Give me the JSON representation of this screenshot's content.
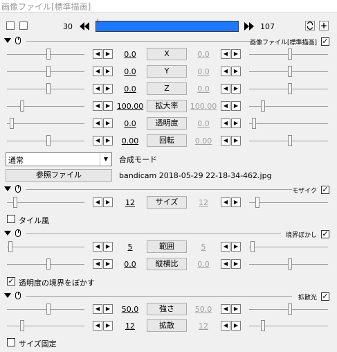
{
  "title_bar": {
    "text": "画像ファイル[標準描画]"
  },
  "toolbar": {
    "start_frame": "30",
    "end_frame": "107",
    "plus_label": "+"
  },
  "sections": {
    "image": {
      "title": "画像ファイル[標準描画]",
      "checked": "✓"
    },
    "mosaic": {
      "title": "モザイク",
      "checked": "✓"
    },
    "border_blur": {
      "title": "境界ぼかし",
      "checked": "✓"
    },
    "diffuse": {
      "title": "拡散光",
      "checked": "✓"
    }
  },
  "params": {
    "x": {
      "label": "X",
      "left": "0.0",
      "right": "0.0"
    },
    "y": {
      "label": "Y",
      "left": "0.0",
      "right": "0.0"
    },
    "z": {
      "label": "Z",
      "left": "0.0",
      "right": "0.0"
    },
    "zoom": {
      "label": "拡大率",
      "left": "100.00",
      "right": "100.00"
    },
    "alpha": {
      "label": "透明度",
      "left": "0.0",
      "right": "0.0"
    },
    "rotate": {
      "label": "回転",
      "left": "0.00",
      "right": "0.00"
    },
    "size": {
      "label": "サイズ",
      "left": "12",
      "right": "12"
    },
    "range": {
      "label": "範囲",
      "left": "5",
      "right": "5"
    },
    "aspect": {
      "label": "縦横比",
      "left": "0.0",
      "right": "0.0"
    },
    "strength": {
      "label": "強さ",
      "left": "50.0",
      "right": "50.0"
    },
    "spread": {
      "label": "拡散",
      "left": "12",
      "right": "12"
    }
  },
  "blend": {
    "value": "通常",
    "caption": "合成モード"
  },
  "file": {
    "button": "参照ファイル",
    "name": "bandicam 2018-05-29 22-18-34-462.jpg"
  },
  "options": {
    "tile": "タイル風",
    "blur_alpha": "透明度の境界をぼかす",
    "blur_alpha_checked": "✓",
    "fixed_size": "サイズ固定"
  },
  "arrows": {
    "left": "◀",
    "right": "▶",
    "dropdown": "▼"
  }
}
